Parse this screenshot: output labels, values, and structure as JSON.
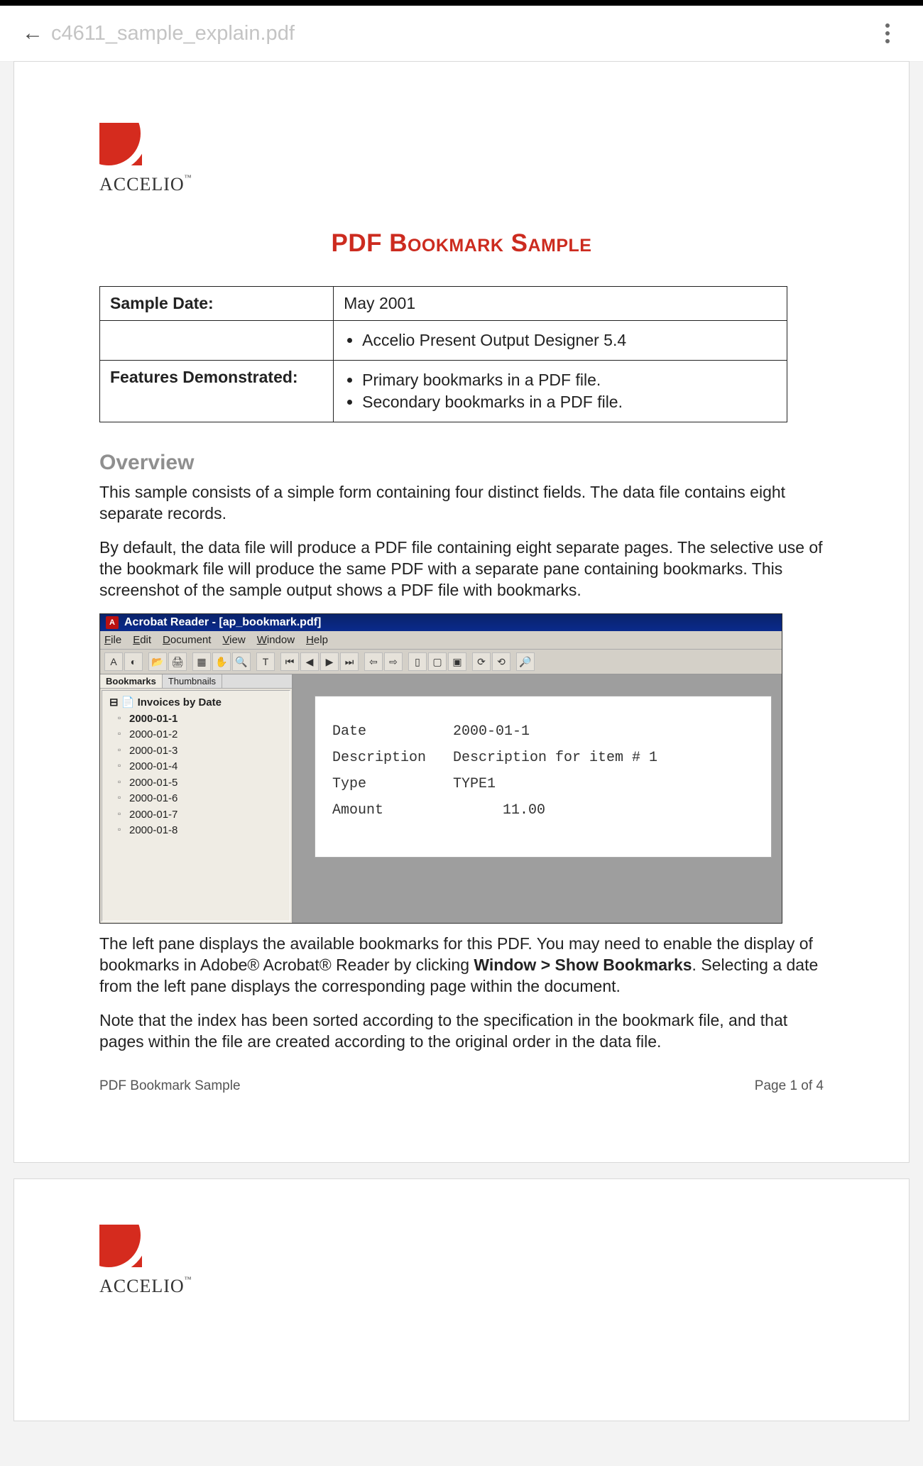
{
  "header": {
    "filename": "c4611_sample_explain.pdf"
  },
  "brand": {
    "name_main": "ACCELIO",
    "name_tm": "™"
  },
  "page1": {
    "title": "PDF Bookmark Sample",
    "row1_label": "Sample Date:",
    "row1_value": "May 2001",
    "row2_value_item1": "Accelio Present Output Designer 5.4",
    "row3_label": "Features Demonstrated:",
    "row3_item1": "Primary bookmarks in a PDF file.",
    "row3_item2": "Secondary bookmarks in a PDF file.",
    "overview_heading": "Overview",
    "para1": "This sample consists of a simple form containing four distinct fields. The data file contains eight separate records.",
    "para2": "By default, the data file will produce a PDF file containing eight separate pages. The selective use of the bookmark file will produce the same PDF with a separate pane containing bookmarks. This screenshot of the sample output shows a PDF file with bookmarks.",
    "para3_a": "The left pane displays the available bookmarks for this PDF. You may need to enable the display of bookmarks in Adobe® Acrobat® Reader by clicking ",
    "para3_bold": "Window > Show Bookmarks",
    "para3_b": ". Selecting a date from the left pane displays the corresponding page within the document.",
    "para4": "Note that the index has been sorted according to the specification in the bookmark file, and that pages within the file are created according to the original order in the data file.",
    "footer_left": "PDF Bookmark Sample",
    "footer_right": "Page 1 of 4"
  },
  "embed": {
    "titlebar": "Acrobat Reader - [ap_bookmark.pdf]",
    "menu": [
      "File",
      "Edit",
      "Document",
      "View",
      "Window",
      "Help"
    ],
    "tabs": {
      "active": "Bookmarks",
      "other": "Thumbnails"
    },
    "root": "Invoices by Date",
    "items": [
      "2000-01-1",
      "2000-01-2",
      "2000-01-3",
      "2000-01-4",
      "2000-01-5",
      "2000-01-6",
      "2000-01-7",
      "2000-01-8"
    ],
    "form": {
      "date_l": "Date",
      "date_v": "2000-01-1",
      "desc_l": "Description",
      "desc_v": "Description for item # 1",
      "type_l": "Type",
      "type_v": "TYPE1",
      "amt_l": "Amount",
      "amt_v": "11.00"
    }
  }
}
